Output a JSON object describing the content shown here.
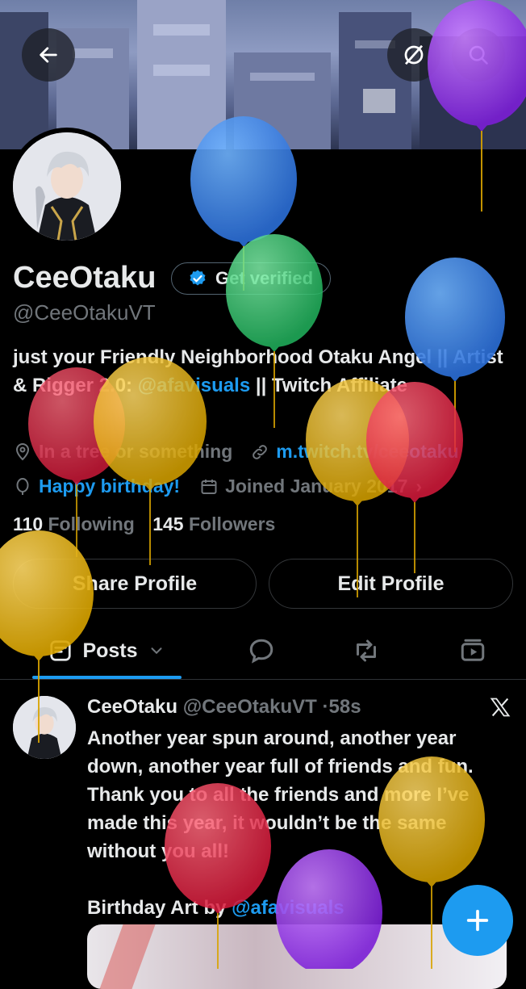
{
  "banner": {
    "back_icon": "arrow-left-icon",
    "grok_icon": "grok-icon",
    "search_icon": "search-icon"
  },
  "profile": {
    "name": "CeeOtaku",
    "verify_label": "Get verified",
    "handle": "@CeeOtakuVT",
    "bio_before": "just your Friendly Neighborhood Otaku Angel || Artist & Rigger 2.0: ",
    "bio_link": "@afavisuals",
    "bio_after": " || Twitch Affiliate",
    "location": "In a tree or something",
    "website": "m.twitch.tv/ceeotaku",
    "birthday": "Happy birthday!",
    "joined": "Joined January 2017",
    "following_count": "110",
    "following_label": "Following",
    "followers_count": "145",
    "followers_label": "Followers"
  },
  "actions": {
    "share": "Share Profile",
    "edit": "Edit Profile"
  },
  "tabs": {
    "posts": "Posts"
  },
  "post": {
    "author": "CeeOtaku",
    "handle": "@CeeOtakuVT",
    "time": "58s",
    "text": "Another year spun around, another year down, another year full of friends and fun. Thank you to all the friends and more I’ve made this year, it wouldn’t be the same without you all!",
    "credit_prefix": "Birthday Art by ",
    "credit_link": "@afavisuals"
  },
  "colors": {
    "accent": "#1d9bf0",
    "text": "#e7e9ea",
    "muted": "#71767b",
    "background": "#000000"
  }
}
